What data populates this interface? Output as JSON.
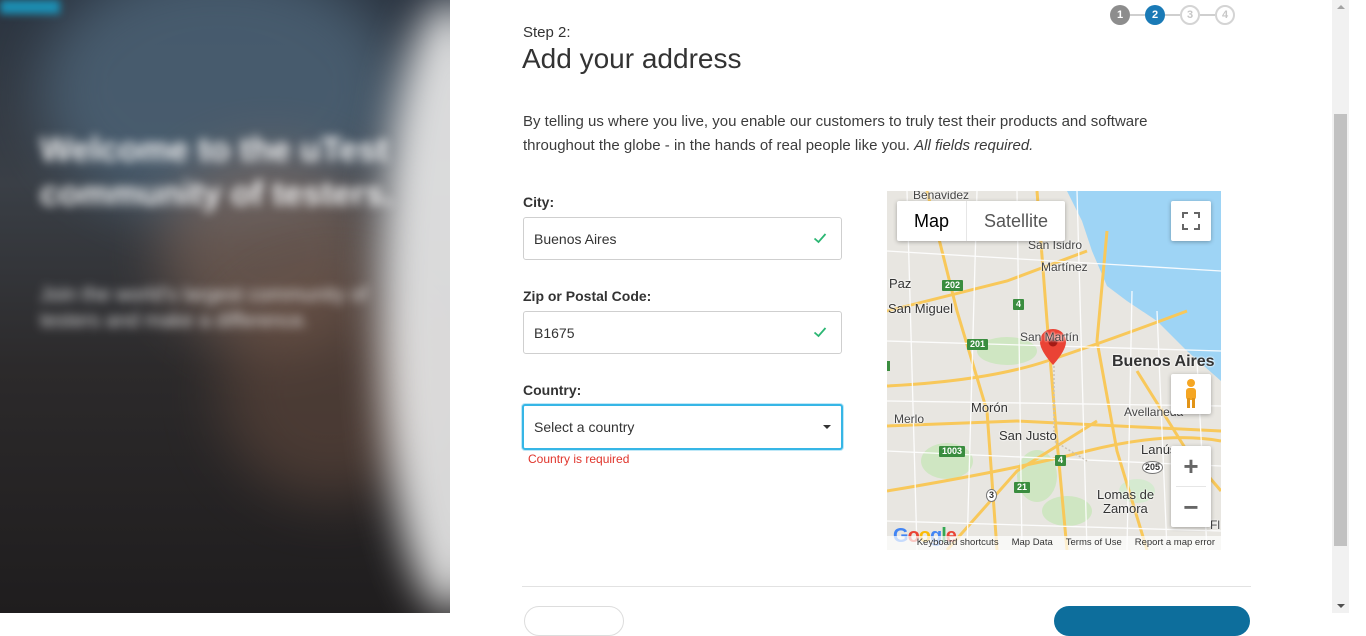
{
  "hero": {
    "headline": "Welcome to the uTest community of testers.",
    "subtext": "Join the world's largest community of testers and make a difference."
  },
  "stepper": {
    "steps": [
      "1",
      "2",
      "3",
      "4"
    ],
    "current": 2
  },
  "page": {
    "step_label": "Step 2:",
    "title": "Add your address",
    "intro": "By telling us where you live, you enable our customers to truly test their products and software throughout the globe - in the hands of real people like you.",
    "intro_em": "All fields required."
  },
  "form": {
    "city": {
      "label": "City:",
      "value": "Buenos Aires"
    },
    "zip": {
      "label": "Zip or Postal Code:",
      "value": "B1675"
    },
    "country": {
      "label": "Country:",
      "placeholder": "Select a country",
      "error": "Country is required"
    }
  },
  "map": {
    "type_map": "Map",
    "type_satellite": "Satellite",
    "zoom_in": "+",
    "zoom_out": "−",
    "labels": {
      "benavidez": "Benavidez",
      "san_isidro": "San Isidro",
      "martinez": "Martínez",
      "paz": "Paz",
      "san_miguel": "San Miguel",
      "san_martin": "San Martín",
      "buenos_aires": "Buenos Aires",
      "moron": "Morón",
      "avellaneda": "Avellaneda",
      "merlo": "Merlo",
      "san_justo": "San Justo",
      "lanus": "Lanús",
      "lomas": "Lomas de",
      "zamora": "Zamora",
      "fl": "Fl"
    },
    "shields": [
      "202",
      "4",
      "201",
      "1003",
      "4",
      "205",
      "3",
      "21"
    ],
    "logo": "Google",
    "attribution": [
      "Keyboard shortcuts",
      "Map Data",
      "Terms of Use",
      "Report a map error"
    ]
  },
  "colors": {
    "accent": "#1a7ab6",
    "focus": "#36b6e6",
    "error": "#e0342b",
    "success": "#2bb673"
  }
}
